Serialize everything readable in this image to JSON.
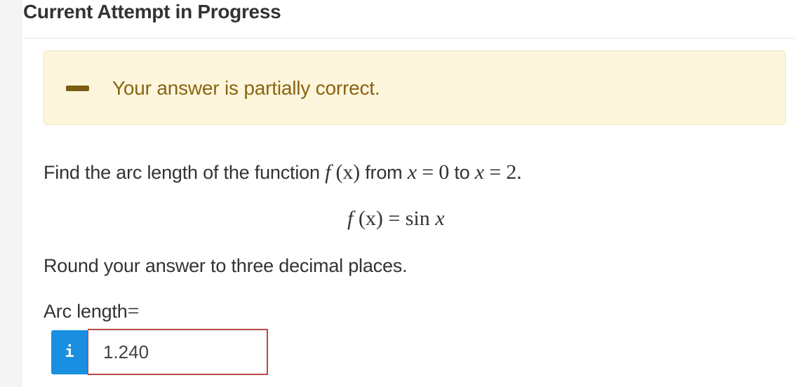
{
  "header": {
    "title": "Current Attempt in Progress"
  },
  "feedback": {
    "icon": "minus-icon",
    "message": "Your answer is partially correct.",
    "status_color": "#8a6412",
    "background_color": "#fdf6dd"
  },
  "question": {
    "intro": "Find the arc length of the function",
    "function_name": "f",
    "function_arg": "(x)",
    "from_text": "from",
    "to_text": "to",
    "var": "x",
    "eq": "=",
    "start": "0",
    "end": "2",
    "period": ".",
    "equation_lhs": "f",
    "equation_arg": "(x)",
    "equation_eq": "=",
    "equation_fn": "sin",
    "equation_var": "x",
    "instruction": "Round your answer to three decimal places."
  },
  "answer": {
    "label": "Arc length",
    "eq": "=",
    "info_label": "i",
    "value": "1.240",
    "accent_color": "#1a8ee0",
    "error_color": "#b44a4a"
  }
}
